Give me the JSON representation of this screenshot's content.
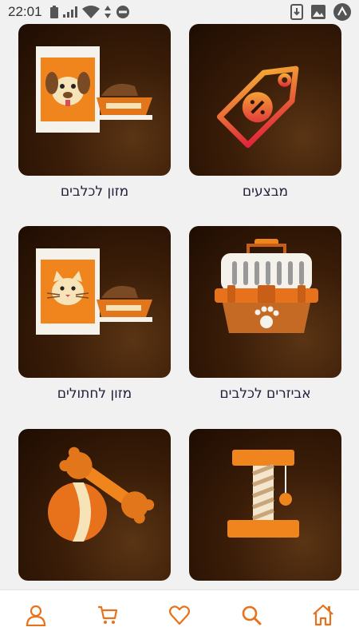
{
  "status_bar": {
    "time": "22:01"
  },
  "theme": {
    "accent": "#e8721c",
    "caption_color": "#1f1f3a",
    "card_bg": "#2a1406"
  },
  "categories": [
    {
      "label": "מבצעים",
      "icon": "price-tag-icon"
    },
    {
      "label": "מזון לכלבים",
      "icon": "dog-food-icon"
    },
    {
      "label": "אביזרים לכלבים",
      "icon": "pet-carrier-icon"
    },
    {
      "label": "מזון לחתולים",
      "icon": "cat-food-icon"
    },
    {
      "label": "",
      "icon": "cat-scratcher-icon"
    },
    {
      "label": "",
      "icon": "toys-icon"
    }
  ],
  "bottom_nav": [
    {
      "icon": "home-icon"
    },
    {
      "icon": "search-icon"
    },
    {
      "icon": "heart-icon"
    },
    {
      "icon": "cart-icon"
    },
    {
      "icon": "user-icon"
    }
  ]
}
